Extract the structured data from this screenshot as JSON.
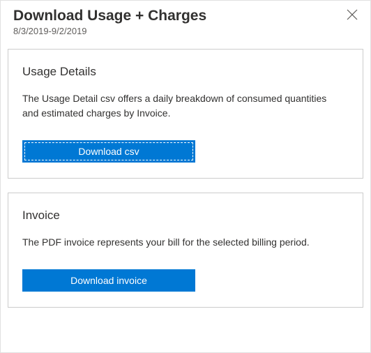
{
  "header": {
    "title": "Download Usage + Charges",
    "subtitle": "8/3/2019-9/2/2019"
  },
  "usage_card": {
    "title": "Usage Details",
    "description": "The Usage Detail csv offers a daily breakdown of consumed quantities and estimated charges by Invoice.",
    "button_label": "Download csv"
  },
  "invoice_card": {
    "title": "Invoice",
    "description": "The PDF invoice represents your bill for the selected billing period.",
    "button_label": "Download invoice"
  }
}
